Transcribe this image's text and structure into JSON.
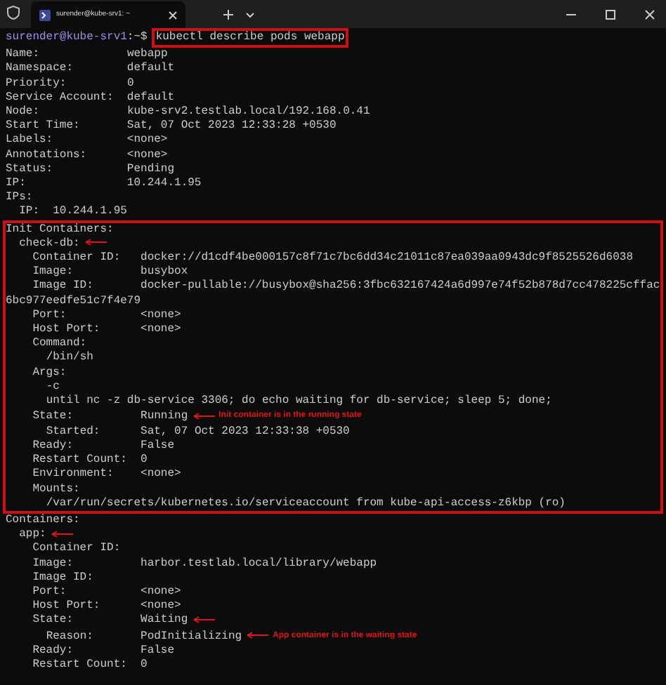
{
  "window": {
    "tab_title": "surender@kube-srv1: ~"
  },
  "prompt": {
    "user_host": "surender@kube-srv1",
    "path": ":~$",
    "command": "kubectl describe pods webapp",
    "command_boxed": true
  },
  "output": [
    {
      "key": "Name:",
      "value": "webapp"
    },
    {
      "key": "Namespace:",
      "value": "default"
    },
    {
      "key": "Priority:",
      "value": "0"
    },
    {
      "key": "Service Account:",
      "value": "default"
    },
    {
      "key": "Node:",
      "value": "kube-srv2.testlab.local/192.168.0.41"
    },
    {
      "key": "Start Time:",
      "value": "Sat, 07 Oct 2023 12:33:28 +0530"
    },
    {
      "key": "Labels:",
      "value": "<none>"
    },
    {
      "key": "Annotations:",
      "value": "<none>"
    },
    {
      "key": "Status:",
      "value": "Pending"
    },
    {
      "key": "IP:",
      "value": "10.244.1.95"
    },
    {
      "key": "IPs:",
      "children": [
        {
          "key": "IP:",
          "value": "10.244.1.95"
        }
      ]
    },
    {
      "key": "Init Containers:",
      "boxed": true,
      "children": [
        {
          "key": "check-db:",
          "arrow": true,
          "children": [
            {
              "key": "Container ID:",
              "value": "docker://d1cdf4be000157c8f71c7bc6dd34c21011c87ea039aa0943dc9f8525526d6038"
            },
            {
              "key": "Image:",
              "value": "busybox"
            },
            {
              "key": "Image ID:",
              "value": "docker-pullable://busybox@sha256:3fbc632167424a6d997e74f52b878d7cc478225cffac6bc977eedfe51c7f4e79"
            },
            {
              "key": "Port:",
              "value": "<none>"
            },
            {
              "key": "Host Port:",
              "value": "<none>"
            },
            {
              "key": "Command:",
              "children": [
                {
                  "text": "/bin/sh"
                }
              ]
            },
            {
              "key": "Args:",
              "children": [
                {
                  "text": "-c"
                },
                {
                  "text": "until nc -z db-service 3306; do echo waiting for db-service; sleep 5; done;"
                }
              ]
            },
            {
              "key": "State:",
              "value": "Running",
              "arrow": true,
              "note": "Init container is in the running state",
              "children": [
                {
                  "key": "Started:",
                  "value": "Sat, 07 Oct 2023 12:33:38 +0530"
                }
              ]
            },
            {
              "key": "Ready:",
              "value": "False"
            },
            {
              "key": "Restart Count:",
              "value": "0"
            },
            {
              "key": "Environment:",
              "value": "<none>"
            },
            {
              "key": "Mounts:",
              "children": [
                {
                  "text": "/var/run/secrets/kubernetes.io/serviceaccount from kube-api-access-z6kbp (ro)"
                }
              ]
            }
          ]
        }
      ]
    },
    {
      "key": "Containers:",
      "children": [
        {
          "key": "app:",
          "arrow": true,
          "children": [
            {
              "key": "Container ID:"
            },
            {
              "key": "Image:",
              "value": "harbor.testlab.local/library/webapp"
            },
            {
              "key": "Image ID:"
            },
            {
              "key": "Port:",
              "value": "<none>"
            },
            {
              "key": "Host Port:",
              "value": "<none>"
            },
            {
              "key": "State:",
              "value": "Waiting",
              "arrow": true,
              "children": [
                {
                  "key": "Reason:",
                  "value": "PodInitializing",
                  "arrow": true,
                  "note": "App container is in the waiting state"
                }
              ]
            },
            {
              "key": "Ready:",
              "value": "False"
            },
            {
              "key": "Restart Count:",
              "value": "0"
            }
          ]
        }
      ]
    }
  ]
}
